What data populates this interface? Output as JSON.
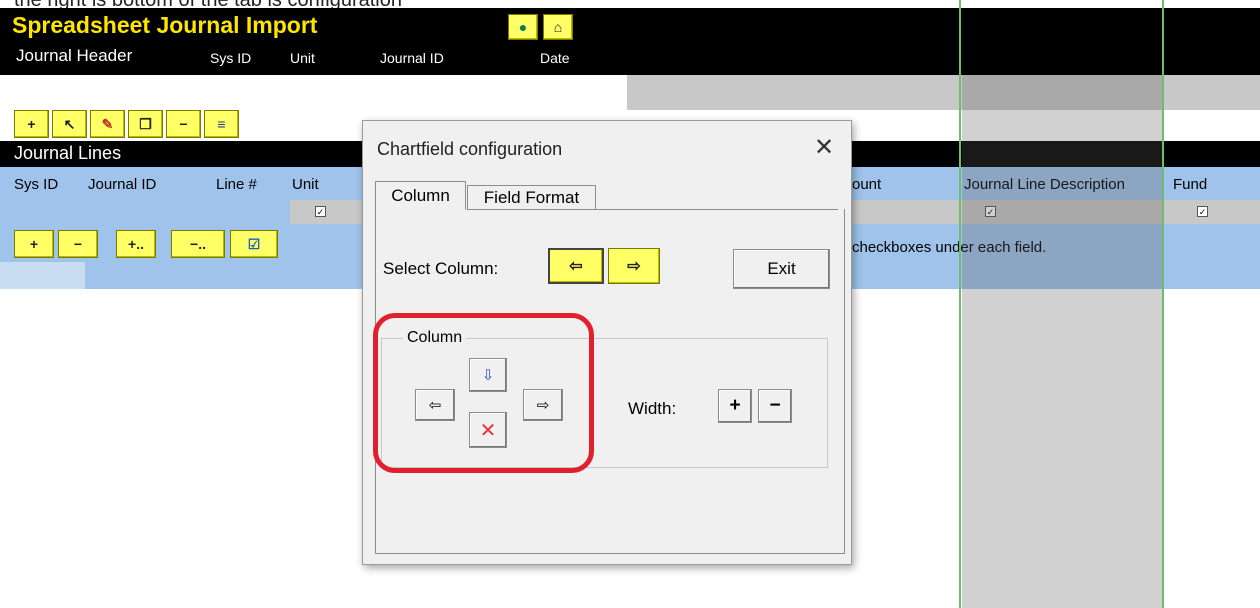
{
  "caption_clipped": "the right is bottom of the tab is configuration",
  "app": {
    "title": "Spreadsheet Journal Import",
    "toolbar_top": [
      "connect-icon",
      "home-icon"
    ]
  },
  "header": {
    "section": "Journal Header",
    "cols": [
      "Sys ID",
      "Unit",
      "Journal ID",
      "Date"
    ]
  },
  "toolbar_header": [
    "+",
    "pointer-icon",
    "pencil-icon",
    "copy-icon",
    "−",
    "list-icon"
  ],
  "lines": {
    "section": "Journal Lines",
    "cols": [
      "Sys ID",
      "Journal ID",
      "Line #",
      "Unit",
      "ount",
      "Journal Line Description",
      "Fund"
    ],
    "toolbar": [
      "+",
      "−",
      "+..",
      "−..",
      "check-icon"
    ],
    "note": "checkboxes under each field."
  },
  "checkbox_glyph": "✓",
  "dialog": {
    "title": "Chartfield configuration",
    "close": "✕",
    "tabs": [
      "Column",
      "Field Format"
    ],
    "select_column_label": "Select Column:",
    "exit_label": "Exit",
    "group_label": "Column",
    "width_label": "Width:",
    "nav_left": "⇦",
    "nav_right": "⇨",
    "move_left": "⇦",
    "move_right": "⇨",
    "insert": "⇩",
    "delete": "✕",
    "width_plus": "+",
    "width_minus": "−"
  }
}
